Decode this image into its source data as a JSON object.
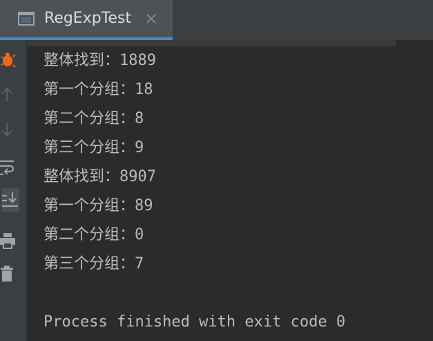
{
  "tab": {
    "title": "RegExpTest",
    "close_symbol": "×"
  },
  "toolbar": {
    "buttons": [
      {
        "icon": "debug-bug-icon",
        "active": false
      },
      {
        "icon": "arrow-up-icon",
        "active": false
      },
      {
        "icon": "arrow-down-icon",
        "active": false
      },
      {
        "icon": "soft-wrap-icon",
        "active": false
      },
      {
        "icon": "scroll-to-end-icon",
        "active": true
      },
      {
        "icon": "print-icon",
        "active": false
      },
      {
        "icon": "trash-icon",
        "active": false
      }
    ]
  },
  "console": {
    "lines": [
      "整体找到：1889",
      "第一个分组：18",
      "第二个分组：8",
      "第三个分组：9",
      "整体找到：8907",
      "第一个分组：89",
      "第二个分组：0",
      "第三个分组：7",
      "",
      "Process finished with exit code 0"
    ]
  },
  "colors": {
    "background": "#2b2b2b",
    "panel": "#3c3f41",
    "tab_active": "#4e5254",
    "tab_underline": "#4a88c7",
    "text": "#bbbbbb",
    "debug_orange": "#f26522"
  }
}
